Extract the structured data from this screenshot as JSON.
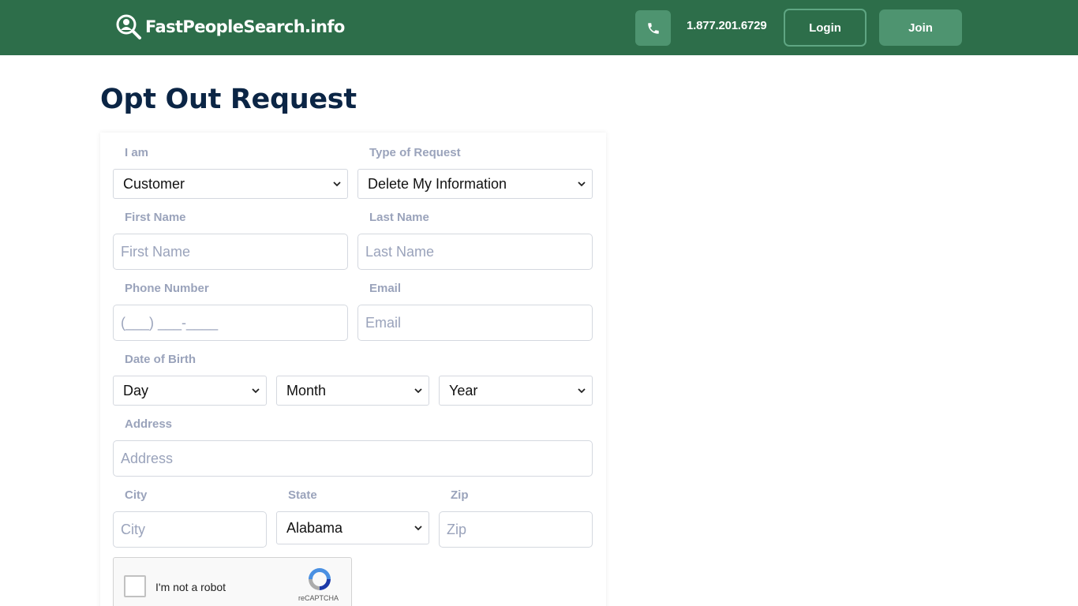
{
  "header": {
    "logo_text": "FastPeopleSearch.info",
    "phone_icon": "phone-icon",
    "phone_number": "1.877.201.6729",
    "login_label": "Login",
    "join_label": "Join"
  },
  "page": {
    "title": "Opt Out Request"
  },
  "form": {
    "i_am": {
      "label": "I am",
      "value": "Customer"
    },
    "request_type": {
      "label": "Type of Request",
      "value": "Delete My Information"
    },
    "first_name": {
      "label": "First Name",
      "placeholder": "First Name"
    },
    "last_name": {
      "label": "Last Name",
      "placeholder": "Last Name"
    },
    "phone": {
      "label": "Phone Number",
      "placeholder": "(___) ___-____"
    },
    "email": {
      "label": "Email",
      "placeholder": "Email"
    },
    "dob": {
      "label": "Date of Birth",
      "day": "Day",
      "month": "Month",
      "year": "Year"
    },
    "address": {
      "label": "Address",
      "placeholder": "Address"
    },
    "city": {
      "label": "City",
      "placeholder": "City"
    },
    "state": {
      "label": "State",
      "value": "Alabama"
    },
    "zip": {
      "label": "Zip",
      "placeholder": "Zip"
    }
  },
  "captcha": {
    "text": "I'm not a robot",
    "brand": "reCAPTCHA"
  },
  "colors": {
    "header_bg": "#2d6e4a",
    "accent": "#4e9470",
    "title": "#0b2545",
    "label": "#9aa3bb"
  }
}
